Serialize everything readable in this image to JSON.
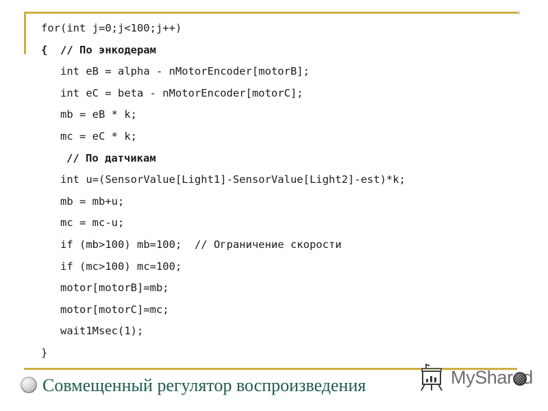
{
  "slide": {
    "code_lines": [
      {
        "text": "for(int j=0;j<100;j++)",
        "indent": "lvl0",
        "comment": false
      },
      {
        "text": "{  // По энкодерам",
        "indent": "lvl1",
        "comment": true
      },
      {
        "text": "int eB = alpha - nMotorEncoder[motorB];",
        "indent": "lvl2",
        "comment": false
      },
      {
        "text": "int eC = beta - nMotorEncoder[motorC];",
        "indent": "lvl2",
        "comment": false
      },
      {
        "text": "mb = eB * k;",
        "indent": "lvl2",
        "comment": false
      },
      {
        "text": "mc = eC * k;",
        "indent": "lvl2",
        "comment": false
      },
      {
        "text": "// По датчикам",
        "indent": "lvl2i",
        "comment": true
      },
      {
        "text": "int u=(SensorValue[Light1]-SensorValue[Light2]-est)*k;",
        "indent": "lvl2",
        "comment": false
      },
      {
        "text": "mb = mb+u;",
        "indent": "lvl2",
        "comment": false
      },
      {
        "text": "mc = mc-u;",
        "indent": "lvl2",
        "comment": false
      },
      {
        "text": "if (mb>100) mb=100;  // Ограничение скорости",
        "indent": "lvl2",
        "comment": false
      },
      {
        "text": "if (mc>100) mc=100;",
        "indent": "lvl2",
        "comment": false
      },
      {
        "text": "motor[motorB]=mb;",
        "indent": "lvl2",
        "comment": false
      },
      {
        "text": "motor[motorC]=mc;",
        "indent": "lvl2",
        "comment": false
      },
      {
        "text": "wait1Msec(1);",
        "indent": "lvl2",
        "comment": false
      },
      {
        "text": "}",
        "indent": "closer",
        "comment": false
      }
    ],
    "footer": {
      "title": "Совмещенный регулятор воспроизведения",
      "bullet_icon": "sphere-bullet-icon"
    },
    "watermark": {
      "text": "MyShared",
      "icon": "flipchart-presentation-icon",
      "sphere_icon": "dark-sphere-icon"
    }
  },
  "colors": {
    "rule_gold": "#c0a026",
    "title_green": "#1f5c4a",
    "code_text": "#1b1b1b",
    "watermark_gray": "#6e6e6e",
    "background": "#ffffff"
  }
}
